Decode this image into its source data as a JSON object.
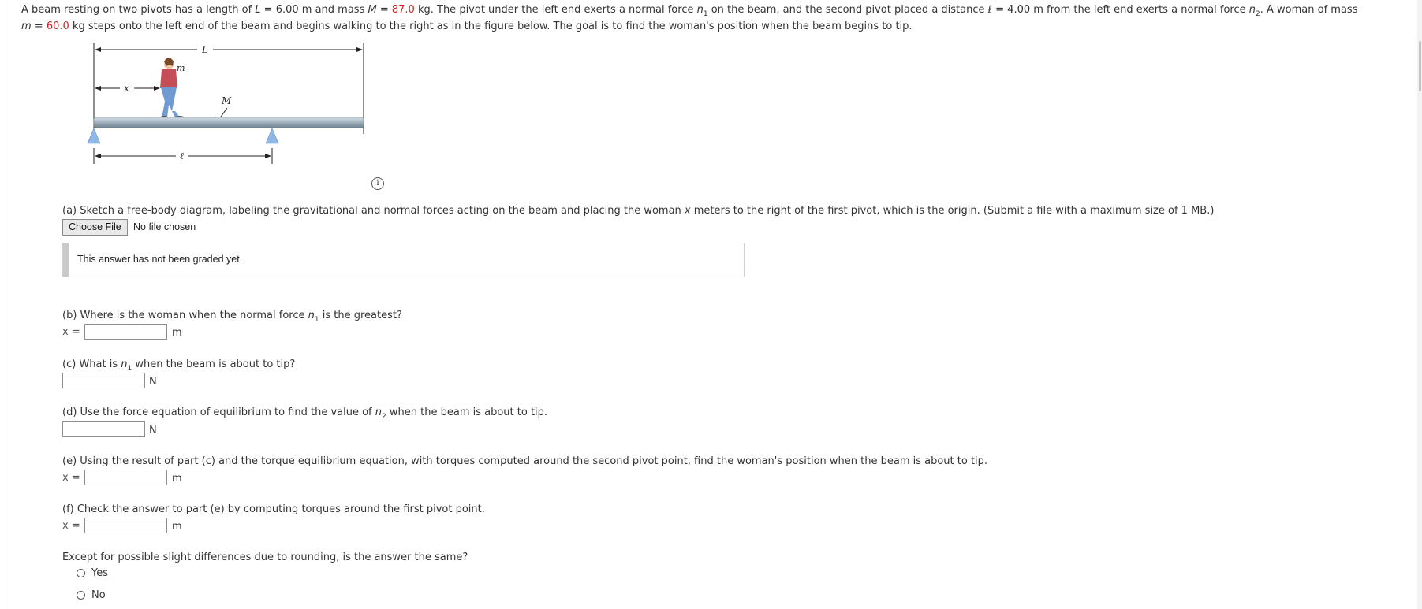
{
  "intro": {
    "p1": "A beam resting on two pivots has a length of ",
    "L_sym": "L",
    "p2": " = 6.00 m and mass ",
    "M_sym": "M",
    "p3": " = ",
    "M_val": "87.0",
    "p4": " kg. The pivot under the left end exerts a normal force ",
    "n_sym": "n",
    "sub1": "1",
    "p5": " on the beam, and the second pivot placed a distance ",
    "ell_sym": "ℓ",
    "p6": " = 4.00 m from the left end exerts a normal force ",
    "n2_sym": "n",
    "sub2": "2",
    "p7": ". A woman of mass ",
    "m_sym": "m",
    "p8": " = ",
    "m_val": "60.0",
    "p9": " kg steps onto the left end of the beam and begins walking to the right as in the figure below. The goal is to find the woman's position when the beam begins to tip."
  },
  "figure": {
    "label_L": "L",
    "label_x": "x",
    "label_m": "m",
    "label_M": "M",
    "label_ell": "ℓ",
    "info_icon": "i"
  },
  "part_a": {
    "p1": "(a) Sketch a free-body diagram, labeling the gravitational and normal forces acting on the beam and placing the woman ",
    "x_sym": "x",
    "p2": " meters to the right of the first pivot, which is the origin. (Submit a file with a maximum size of 1 MB.)",
    "button": "Choose File",
    "status": "No file chosen",
    "graded": "This answer has not been graded yet."
  },
  "part_b": {
    "p1": "(b) Where is the woman when the normal force ",
    "n_sym": "n",
    "sub": "1",
    "p2": " is the greatest?",
    "label": "x =",
    "value": "",
    "unit": "m"
  },
  "part_c": {
    "p1": "(c) What is ",
    "n_sym": "n",
    "sub": "1",
    "p2": " when the beam is about to tip?",
    "value": "",
    "unit": "N"
  },
  "part_d": {
    "p1": "(d) Use the force equation of equilibrium to find the value of ",
    "n_sym": "n",
    "sub": "2",
    "p2": " when the beam is about to tip.",
    "value": "",
    "unit": "N"
  },
  "part_e": {
    "text": "(e) Using the result of part (c) and the torque equilibrium equation, with torques computed around the second pivot point, find the woman's position when the beam is about to tip.",
    "label": "x =",
    "value": "",
    "unit": "m"
  },
  "part_f": {
    "text": "(f) Check the answer to part (e) by computing torques around the first pivot point.",
    "label": "x =",
    "value": "",
    "unit": "m"
  },
  "compare": {
    "question": "Except for possible slight differences due to rounding, is the answer the same?",
    "options": [
      "Yes",
      "No"
    ]
  },
  "colors": {
    "given_value": "#d21f1f",
    "beam": "#9fb0bd",
    "pivot": "#8fb8e6"
  }
}
